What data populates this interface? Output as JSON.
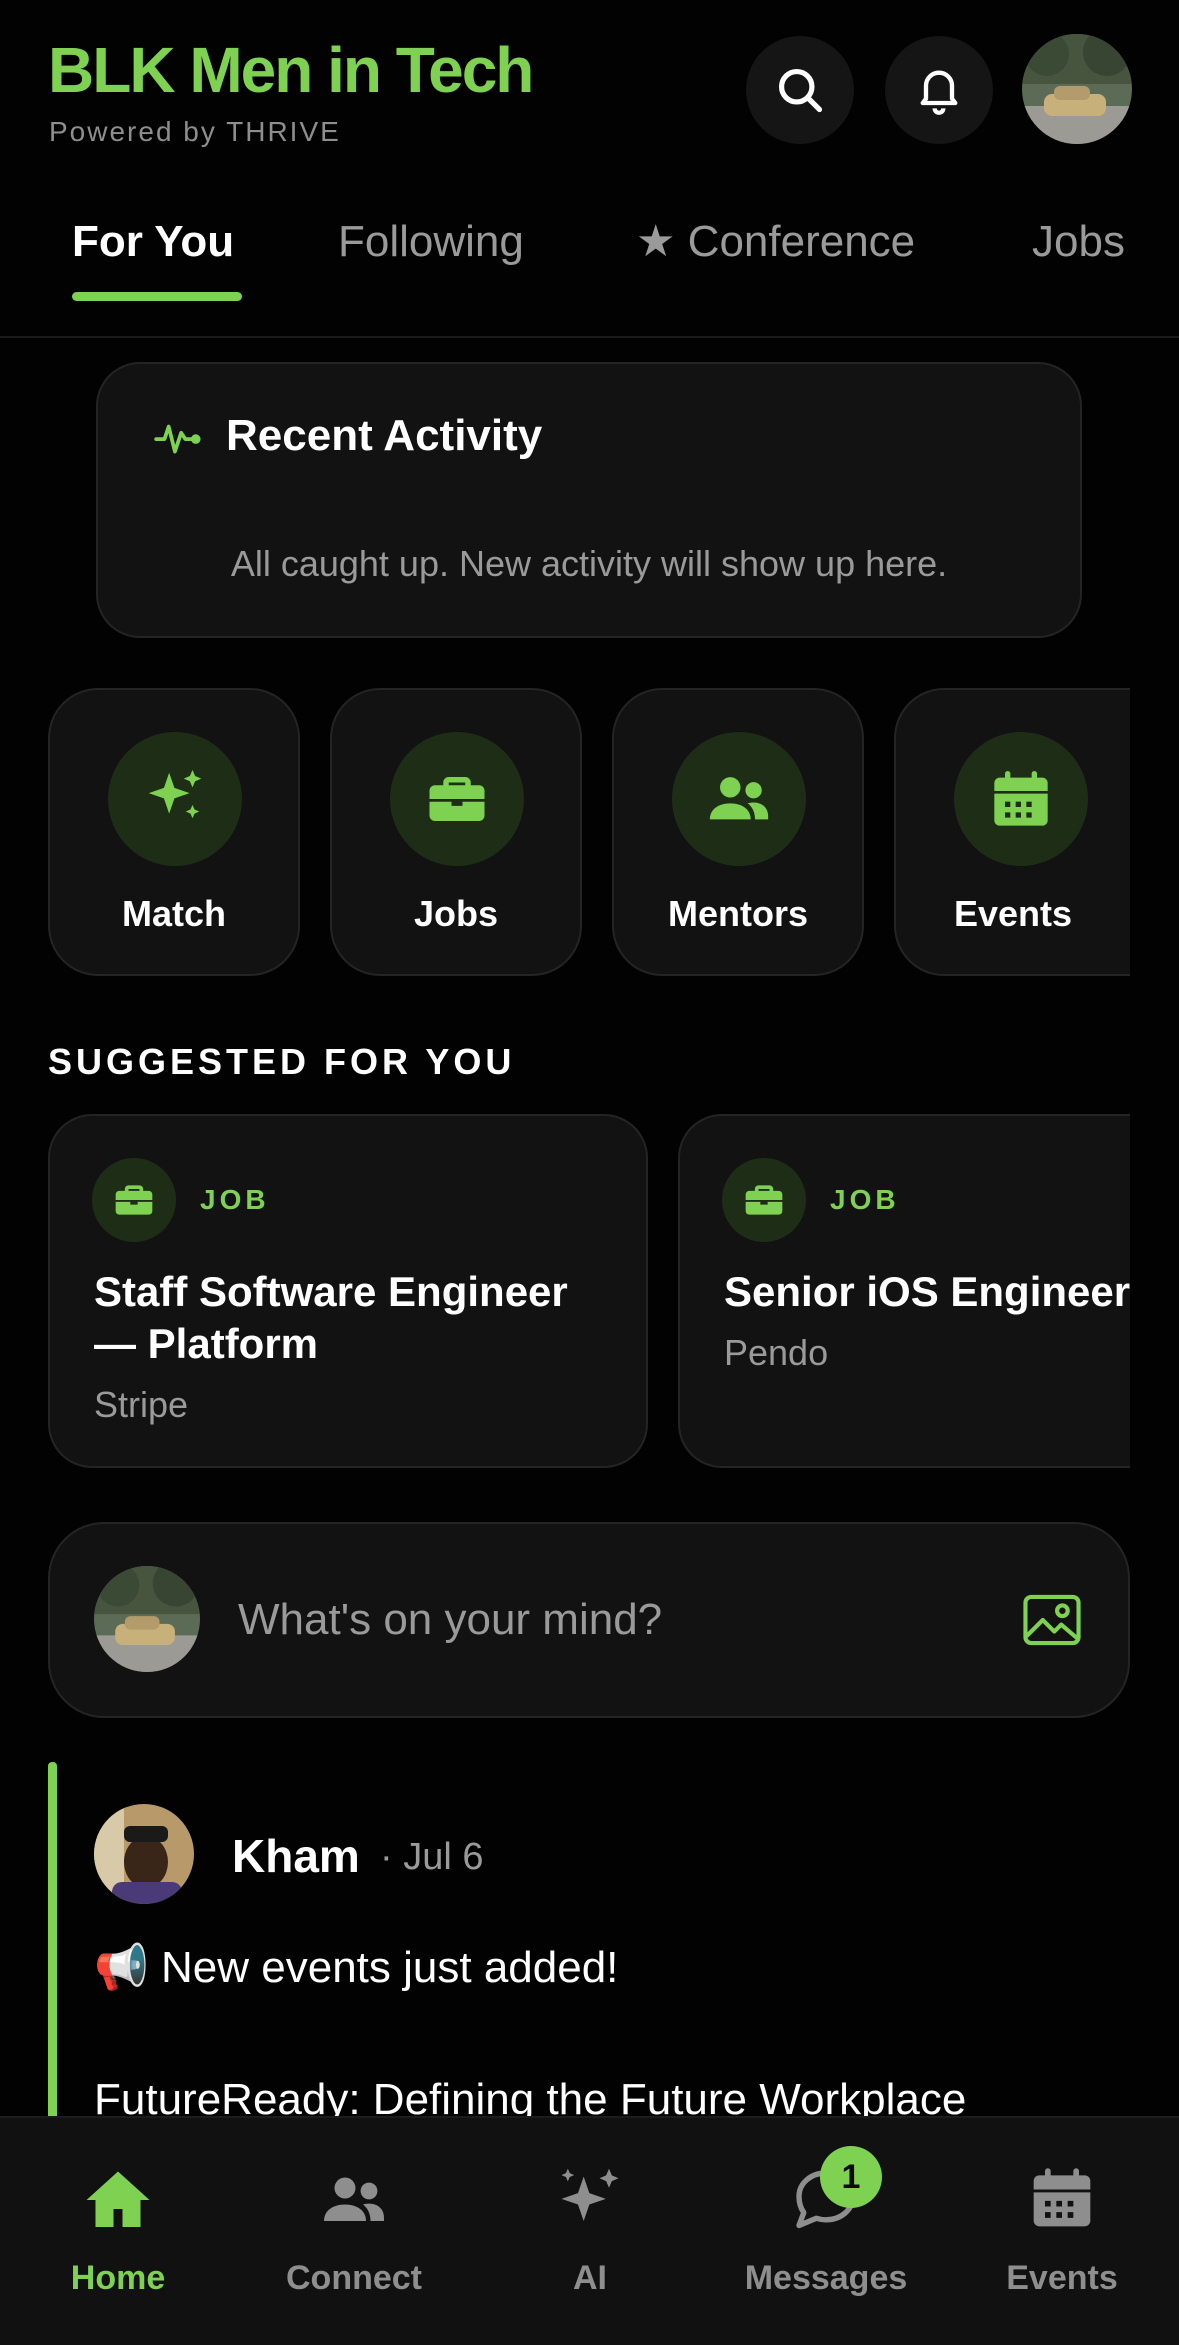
{
  "header": {
    "title": "BLK Men in Tech",
    "subtitle": "Powered by THRIVE",
    "search_icon": "search-icon",
    "bell_icon": "bell-icon"
  },
  "tabs": [
    {
      "label": "For You",
      "active": true
    },
    {
      "label": "Following",
      "active": false
    },
    {
      "label": "★ Conference",
      "active": false
    },
    {
      "label": "Jobs",
      "active": false
    }
  ],
  "recent_activity": {
    "title": "Recent Activity",
    "empty_text": "All caught up. New activity will show up here.",
    "icon": "activity-pulse-icon"
  },
  "quick_actions": [
    {
      "label": "Match",
      "icon": "sparkles-icon"
    },
    {
      "label": "Jobs",
      "icon": "briefcase-icon"
    },
    {
      "label": "Mentors",
      "icon": "people-icon"
    },
    {
      "label": "Events",
      "icon": "calendar-icon"
    }
  ],
  "suggested": {
    "title": "SUGGESTED FOR YOU",
    "items": [
      {
        "tag": "JOB",
        "title": "Staff Software Engineer — Platform",
        "company": "Stripe"
      },
      {
        "tag": "JOB",
        "title": "Senior iOS Engineer",
        "company": "Pendo"
      }
    ]
  },
  "composer": {
    "placeholder": "What's on your mind?",
    "icon": "image-icon"
  },
  "post": {
    "author": "Kham",
    "date": "· Jul 6",
    "line1": "📢 New events just added!",
    "line2": "FutureReady: Defining the Future Workplace"
  },
  "bottom_nav": [
    {
      "label": "Home",
      "icon": "home-icon",
      "active": true
    },
    {
      "label": "Connect",
      "icon": "people-icon",
      "active": false
    },
    {
      "label": "AI",
      "icon": "sparkles-icon",
      "active": false
    },
    {
      "label": "Messages",
      "icon": "chat-bubble-icon",
      "active": false
    },
    {
      "label": "Events",
      "icon": "calendar-icon",
      "active": false
    }
  ],
  "messages_badge": "1",
  "colors": {
    "accent": "#7fd152",
    "background": "#020202",
    "card": "#121212",
    "muted_text": "#9a9a9a"
  }
}
